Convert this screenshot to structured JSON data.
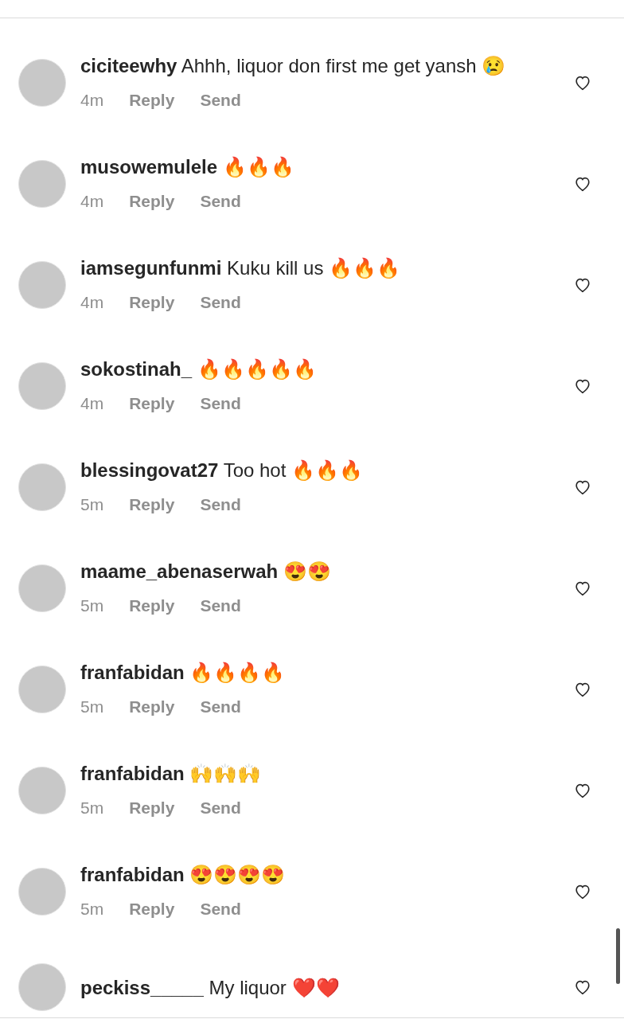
{
  "comments": [
    {
      "username": "ciciteewhy",
      "text": "Ahhh, liquor don first me get yansh 😢",
      "time": "4m",
      "reply": "Reply",
      "send": "Send",
      "liked": false
    },
    {
      "username": "musowemulele",
      "text": "🔥🔥🔥",
      "time": "4m",
      "reply": "Reply",
      "send": "Send",
      "liked": false
    },
    {
      "username": "iamsegunfunmi",
      "text": "Kuku kill us 🔥🔥🔥",
      "time": "4m",
      "reply": "Reply",
      "send": "Send",
      "liked": false
    },
    {
      "username": "sokostinah_",
      "text": "🔥🔥🔥🔥🔥",
      "time": "4m",
      "reply": "Reply",
      "send": "Send",
      "liked": false
    },
    {
      "username": "blessingovat27",
      "text": "Too hot 🔥🔥🔥",
      "time": "5m",
      "reply": "Reply",
      "send": "Send",
      "liked": false
    },
    {
      "username": "maame_abenaserwah",
      "text": "😍😍",
      "time": "5m",
      "reply": "Reply",
      "send": "Send",
      "liked": false
    },
    {
      "username": "franfabidan",
      "text": "🔥🔥🔥🔥",
      "time": "5m",
      "reply": "Reply",
      "send": "Send",
      "liked": false
    },
    {
      "username": "franfabidan",
      "text": "🙌🙌🙌",
      "time": "5m",
      "reply": "Reply",
      "send": "Send",
      "liked": false
    },
    {
      "username": "franfabidan",
      "text": "😍😍😍😍",
      "time": "5m",
      "reply": "Reply",
      "send": "Send",
      "liked": false
    },
    {
      "username": "peckiss_____",
      "text": "My liquor ❤️❤️",
      "liked": false
    }
  ]
}
